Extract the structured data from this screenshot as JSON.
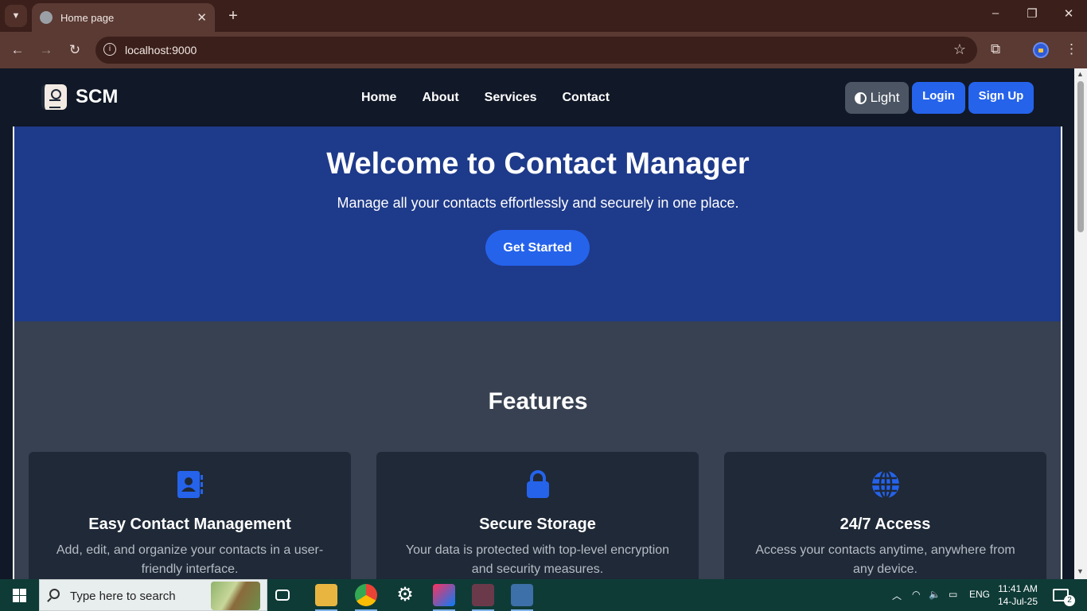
{
  "browser": {
    "tab_title": "Home page",
    "url": "localhost:9000"
  },
  "navbar": {
    "brand": "SCM",
    "links": [
      "Home",
      "About",
      "Services",
      "Contact"
    ],
    "theme_button": "Light",
    "login_button": "Login",
    "signup_button": "Sign Up"
  },
  "hero": {
    "title": "Welcome to Contact Manager",
    "subtitle": "Manage all your contacts effortlessly and securely in one place.",
    "cta": "Get Started"
  },
  "features": {
    "heading": "Features",
    "cards": [
      {
        "icon": "address-book-icon",
        "title": "Easy Contact Management",
        "text": "Add, edit, and organize your contacts in a user-friendly interface."
      },
      {
        "icon": "lock-icon",
        "title": "Secure Storage",
        "text": "Your data is protected with top-level encryption and security measures."
      },
      {
        "icon": "globe-icon",
        "title": "24/7 Access",
        "text": "Access your contacts anytime, anywhere from any device."
      }
    ]
  },
  "taskbar": {
    "search_placeholder": "Type here to search",
    "language": "ENG",
    "time": "11:41 AM",
    "date": "14-Jul-25",
    "notification_count": "2"
  },
  "colors": {
    "accent": "#2563eb",
    "hero_bg": "#1e3a8a",
    "features_bg": "#374151",
    "card_bg": "#1f2937",
    "navbar_bg": "#111827"
  }
}
